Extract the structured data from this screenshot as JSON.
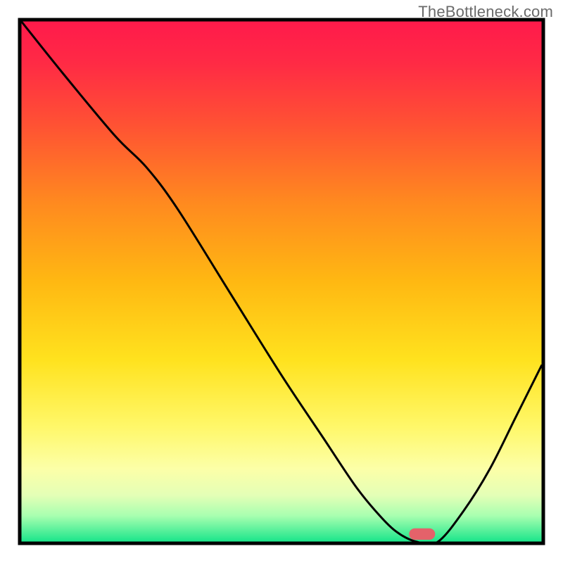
{
  "watermark": "TheBottleneck.com",
  "chart_data": {
    "type": "line",
    "title": "",
    "xlabel": "",
    "ylabel": "",
    "xlim": [
      0,
      100
    ],
    "ylim": [
      0,
      100
    ],
    "background_gradient": {
      "stops": [
        {
          "offset": 0.0,
          "color": "#ff1a4b"
        },
        {
          "offset": 0.08,
          "color": "#ff2a45"
        },
        {
          "offset": 0.2,
          "color": "#ff5233"
        },
        {
          "offset": 0.35,
          "color": "#ff8a1f"
        },
        {
          "offset": 0.5,
          "color": "#ffb812"
        },
        {
          "offset": 0.65,
          "color": "#ffe21e"
        },
        {
          "offset": 0.78,
          "color": "#fff86a"
        },
        {
          "offset": 0.86,
          "color": "#fcffa8"
        },
        {
          "offset": 0.91,
          "color": "#e4ffb6"
        },
        {
          "offset": 0.95,
          "color": "#a8ffb0"
        },
        {
          "offset": 1.0,
          "color": "#19e58b"
        }
      ]
    },
    "series": [
      {
        "name": "bottleneck-curve",
        "color": "#000000",
        "x": [
          0,
          8,
          18,
          24,
          30,
          40,
          50,
          58,
          64,
          68,
          72,
          76,
          80,
          85,
          90,
          95,
          100
        ],
        "y": [
          100,
          90,
          78,
          72,
          64,
          48,
          32,
          20,
          11,
          6,
          2,
          0,
          0,
          6,
          14,
          24,
          34
        ]
      }
    ],
    "marker": {
      "name": "optimal-point",
      "x": 77,
      "y": 1.5,
      "color": "#e4626a",
      "width": 5,
      "height": 2.2
    },
    "grid": false,
    "legend": false
  }
}
